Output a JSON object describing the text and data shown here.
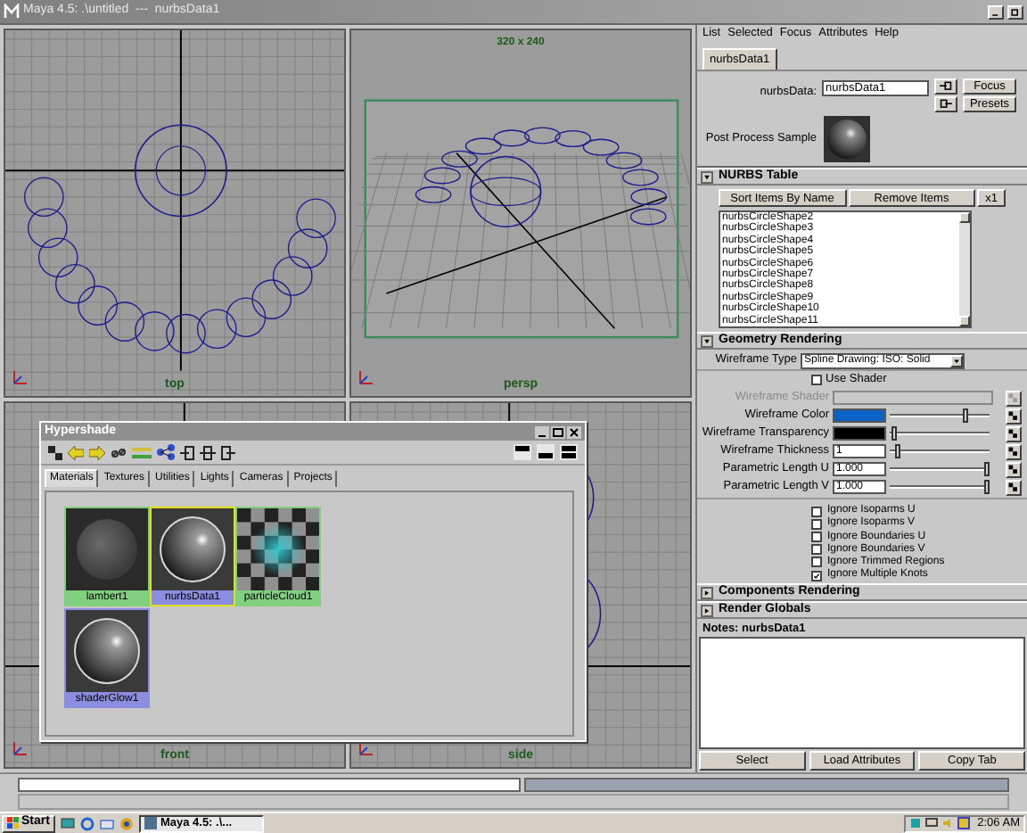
{
  "window": {
    "title": "Maya 4.5: .\\untitled  ---  nurbsData1"
  },
  "viewports": [
    {
      "label": "top",
      "kind": "top"
    },
    {
      "label": "persp",
      "kind": "persp"
    },
    {
      "label": "front",
      "kind": "front"
    },
    {
      "label": "side",
      "kind": "side"
    }
  ],
  "resolution_gate": {
    "label": "320 x 240"
  },
  "hypershade": {
    "title": "Hypershade",
    "tabs": [
      {
        "label": "Materials",
        "selected": true
      },
      {
        "label": "Textures",
        "selected": false
      },
      {
        "label": "Utilities",
        "selected": false
      },
      {
        "label": "Lights",
        "selected": false
      },
      {
        "label": "Cameras",
        "selected": false
      },
      {
        "label": "Projects",
        "selected": false
      }
    ],
    "swatches": [
      {
        "label": "lambert1",
        "kind": "matte",
        "selected": false,
        "color": "#80d080"
      },
      {
        "label": "nurbsData1",
        "kind": "shiny",
        "selected": true,
        "color": "#8c8ce0"
      },
      {
        "label": "particleCloud1",
        "kind": "checker",
        "selected": false,
        "color": "#80d080"
      },
      {
        "label": "shaderGlow1",
        "kind": "shiny",
        "selected": false,
        "color": "#8c8ce0"
      }
    ]
  },
  "attribute_editor": {
    "menu": [
      "List",
      "Selected",
      "Focus",
      "Attributes",
      "Help"
    ],
    "tabs": [
      {
        "label": "nurbsData1",
        "selected": true
      }
    ],
    "name_label": "nurbsData:",
    "name_value": "nurbsData1",
    "buttons": [
      "Focus",
      "Presets"
    ],
    "sample_label": "Post Process Sample",
    "nurbs_table": {
      "title": "NURBS Table",
      "expanded": true,
      "buttons": [
        "Sort Items By Name",
        "Remove Items",
        "x1"
      ],
      "items": [
        "nurbsCircleShape2",
        "nurbsCircleShape3",
        "nurbsCircleShape4",
        "nurbsCircleShape5",
        "nurbsCircleShape6",
        "nurbsCircleShape7",
        "nurbsCircleShape8",
        "nurbsCircleShape9",
        "nurbsCircleShape10",
        "nurbsCircleShape11"
      ]
    },
    "geometry_rendering": {
      "title": "Geometry Rendering",
      "expanded": true,
      "wireframe_type": {
        "label": "Wireframe Type",
        "value": "Spline Drawing: ISO: Solid"
      },
      "use_shader": {
        "label": "Use Shader",
        "checked": false
      },
      "attributes": [
        {
          "label": "Wireframe Shader",
          "kind": "shader",
          "disabled": true
        },
        {
          "label": "Wireframe Color",
          "kind": "color",
          "color": "#0a64c8",
          "level": 0.78,
          "disabled": false
        },
        {
          "label": "Wireframe Transparency",
          "kind": "color",
          "color": "#000000",
          "level": 0.02,
          "disabled": false
        },
        {
          "label": "Wireframe Thickness",
          "kind": "number",
          "value": "1",
          "level": 0.06,
          "disabled": false
        },
        {
          "label": "Parametric Length U",
          "kind": "number",
          "value": "1.000",
          "level": 1,
          "disabled": false
        },
        {
          "label": "Parametric Length V",
          "kind": "number",
          "value": "1.000",
          "level": 1,
          "disabled": false
        }
      ],
      "checkboxes": [
        {
          "label": "Ignore Isoparms U",
          "checked": false
        },
        {
          "label": "Ignore Isoparms V",
          "checked": false
        },
        {
          "label": "Ignore Boundaries U",
          "checked": false
        },
        {
          "label": "Ignore Boundaries V",
          "checked": false
        },
        {
          "label": "Ignore Trimmed Regions",
          "checked": false
        },
        {
          "label": "Ignore Multiple Knots",
          "checked": true
        }
      ]
    },
    "collapsed_sections": [
      {
        "title": "Components Rendering",
        "expanded": false
      },
      {
        "title": "Render Globals",
        "expanded": false
      }
    ],
    "notes": {
      "title": "Notes: nurbsData1"
    },
    "bottom_buttons": [
      "Select",
      "Load Attributes",
      "Copy Tab"
    ]
  },
  "taskbar": {
    "start": "Start",
    "tasks": [
      {
        "label": "Maya 4.5: .\\...",
        "selected": true
      }
    ],
    "clock": "2:06 AM"
  }
}
